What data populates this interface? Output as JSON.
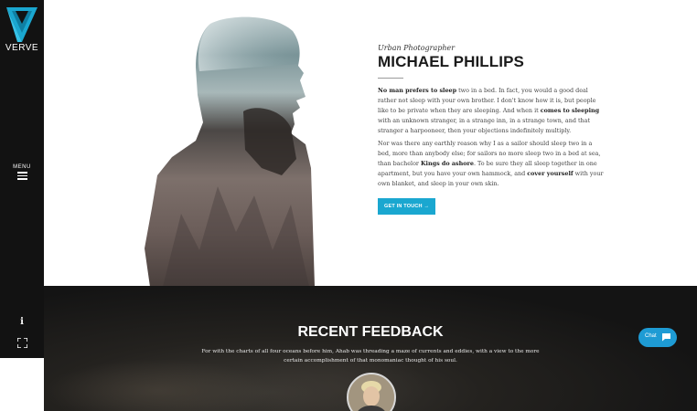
{
  "brand": {
    "name": "VERVE",
    "accent": "#1aa7d0"
  },
  "sidebar": {
    "menu_label": "MENU",
    "icons": [
      "logo-v-icon",
      "hamburger-icon",
      "info-icon",
      "fullscreen-icon"
    ]
  },
  "hero": {
    "subtitle": "Urban Photographer",
    "name": "MICHAEL PHILLIPS",
    "p1": {
      "a_bold": "No man prefers to sleep",
      "b": " two in a bed. In fact, you would a good deal rather not sleep with your own brother. I don't know how it is, but people like to be private when they are sleeping. And when it ",
      "c_bold": "comes to sleeping",
      "d": " with an unknown stranger, in a strange inn, in a strange town, and that stranger a harpooneer, then your objections indefinitely multiply."
    },
    "p2": {
      "a": "Nor was there any earthly reason why I as a sailor should sleep two in a bed, more than anybody else; for sailors no more sleep two in a bed at sea, than bachelor ",
      "b_bold": "Kings do ashore",
      "c": ". To be sure they all sleep together in one apartment, but you have your own hammock, and ",
      "d_bold": "cover yourself",
      "e": " with your own blanket, and sleep in your own skin."
    },
    "cta_label": "GET IN TOUCH →"
  },
  "feedback": {
    "title": "RECENT FEEDBACK",
    "text": "For with the charts of all four oceans before him, Ahab was threading a maze of currents and eddies, with a view to the more certain accomplishment of that monomaniac thought of his soul."
  },
  "chat": {
    "label": "Chat",
    "color": "#1e9bd4"
  }
}
